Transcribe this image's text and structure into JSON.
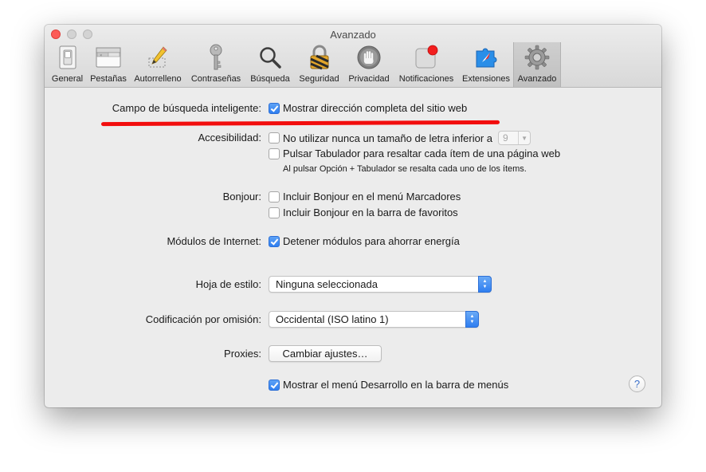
{
  "window": {
    "title": "Avanzado"
  },
  "tabs": [
    {
      "label": "General",
      "icon": "general-switch-icon"
    },
    {
      "label": "Pestañas",
      "icon": "tabs-icon"
    },
    {
      "label": "Autorrelleno",
      "icon": "pencil-icon"
    },
    {
      "label": "Contraseñas",
      "icon": "key-icon"
    },
    {
      "label": "Búsqueda",
      "icon": "magnifier-icon"
    },
    {
      "label": "Seguridad",
      "icon": "padlock-icon"
    },
    {
      "label": "Privacidad",
      "icon": "hand-icon"
    },
    {
      "label": "Notificaciones",
      "icon": "notification-icon"
    },
    {
      "label": "Extensiones",
      "icon": "puzzle-compass-icon"
    },
    {
      "label": "Avanzado",
      "icon": "gear-icon",
      "active": true
    }
  ],
  "smart_search": {
    "label": "Campo de búsqueda inteligente:",
    "option": "Mostrar dirección completa del sitio web",
    "checked": true
  },
  "accessibility": {
    "label": "Accesibilidad:",
    "min_font_option": "No utilizar nunca un tamaño de letra inferior a",
    "min_font_value": "9",
    "min_font_checked": false,
    "tab_option": "Pulsar Tabulador para resaltar cada ítem de una página web",
    "tab_checked": false,
    "tab_note": "Al pulsar Opción + Tabulador se resalta cada uno de los ítems."
  },
  "bonjour": {
    "label": "Bonjour:",
    "bookmarks_option": "Incluir Bonjour en el menú Marcadores",
    "bookmarks_checked": false,
    "favorites_option": "Incluir Bonjour en la barra de favoritos",
    "favorites_checked": false
  },
  "plugins": {
    "label": "Módulos de Internet:",
    "option": "Detener módulos para ahorrar energía",
    "checked": true
  },
  "stylesheet": {
    "label": "Hoja de estilo:",
    "value": "Ninguna seleccionada"
  },
  "encoding": {
    "label": "Codificación por omisión:",
    "value": "Occidental (ISO latino 1)"
  },
  "proxies": {
    "label": "Proxies:",
    "button": "Cambiar ajustes…"
  },
  "develop": {
    "option": "Mostrar el menú Desarrollo en la barra de menús",
    "checked": true
  },
  "help": {
    "label": "?"
  },
  "colors": {
    "annotation_red": "#f20d0d",
    "checkbox_blue": "#2f7ef0",
    "close_red": "#fc5b57"
  }
}
